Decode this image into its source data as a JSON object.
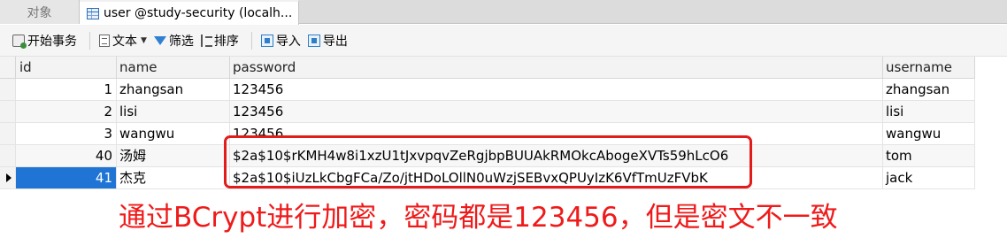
{
  "tabs": {
    "objects": "对象",
    "table": "user @study-security (localh..."
  },
  "toolbar": {
    "begin_transaction": "开始事务",
    "text": "文本",
    "filter": "筛选",
    "sort": "排序",
    "import": "导入",
    "export": "导出"
  },
  "columns": {
    "id": "id",
    "name": "name",
    "password": "password",
    "username": "username"
  },
  "rows": [
    {
      "id": "1",
      "name": "zhangsan",
      "password": "123456",
      "username": "zhangsan"
    },
    {
      "id": "2",
      "name": "lisi",
      "password": "123456",
      "username": "lisi"
    },
    {
      "id": "3",
      "name": "wangwu",
      "password": "123456",
      "username": "wangwu"
    },
    {
      "id": "40",
      "name": "汤姆",
      "password": "$2a$10$rKMH4w8i1xzU1tJxvpqvZeRgjbpBUUAkRMOkcAbogeXVTs59hLcO6",
      "username": "tom"
    },
    {
      "id": "41",
      "name": "杰克",
      "password": "$2a$10$iUzLkCbgFCa/Zo/jtHDoLOllN0uWzjSEBvxQPUyIzK6VfTmUzFVbK",
      "username": "jack"
    }
  ],
  "selected_row_index": 4,
  "annotation": {
    "caption": "通过BCrypt进行加密，密码都是123456，但是密文不一致",
    "color": "#e21b1b"
  },
  "colors": {
    "selection": "#1f74d4",
    "accent": "#2f7fd3"
  },
  "icons": [
    "table-icon",
    "transaction-icon",
    "text-icon",
    "filter-icon",
    "sort-icon",
    "import-icon",
    "export-icon",
    "row-pointer-icon"
  ]
}
